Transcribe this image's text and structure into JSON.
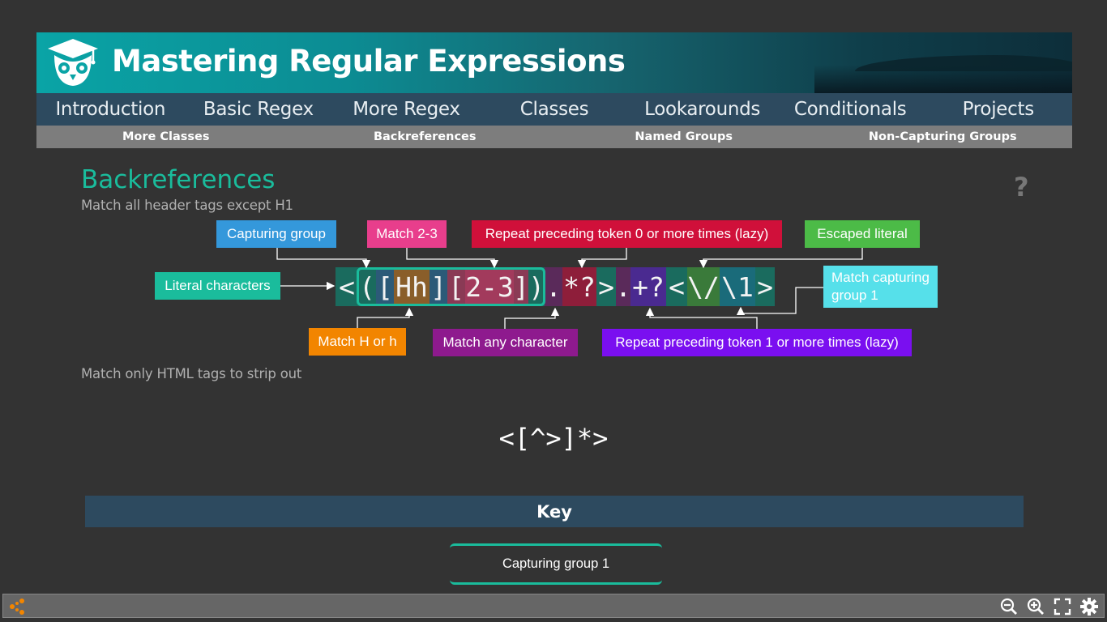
{
  "header": {
    "title": "Mastering Regular Expressions"
  },
  "nav": [
    {
      "label": "Introduction"
    },
    {
      "label": "Basic Regex"
    },
    {
      "label": "More Regex"
    },
    {
      "label": "Classes"
    },
    {
      "label": "Lookarounds"
    },
    {
      "label": "Conditionals"
    },
    {
      "label": "Projects"
    }
  ],
  "subnav": [
    {
      "label": "More Classes"
    },
    {
      "label": "Backreferences"
    },
    {
      "label": "Named Groups"
    },
    {
      "label": "Non-Capturing Groups"
    }
  ],
  "main": {
    "heading": "Backreferences",
    "help": "?",
    "example1": {
      "description": "Match all header tags except H1",
      "tokens": [
        {
          "text": "<",
          "color": "#1a6b5e"
        },
        {
          "text": "(",
          "color": "#1a6b5e"
        },
        {
          "text": "[",
          "color": "#2c5a78"
        },
        {
          "text": "Hh",
          "color": "#8a5e2a"
        },
        {
          "text": "]",
          "color": "#2c5a78"
        },
        {
          "text": "[",
          "color": "#8a3a55"
        },
        {
          "text": "2-3",
          "color": "#a23a5c"
        },
        {
          "text": "]",
          "color": "#8a3a55"
        },
        {
          "text": ")",
          "color": "#1a6b5e"
        },
        {
          "text": ".",
          "color": "#5a2a5a"
        },
        {
          "text": "*?",
          "color": "#8e1e3a"
        },
        {
          "text": ">",
          "color": "#1a6b5e"
        },
        {
          "text": ".",
          "color": "#5a2a5a"
        },
        {
          "text": "+?",
          "color": "#4a2a90"
        },
        {
          "text": "<",
          "color": "#1a6b5e"
        },
        {
          "text": "\\/",
          "color": "#3a7a3a"
        },
        {
          "text": "\\1",
          "color": "#1a6b7a"
        },
        {
          "text": ">",
          "color": "#1a6b5e"
        }
      ],
      "annotations": {
        "capturing_group": {
          "label": "Capturing group",
          "color": "#3498db"
        },
        "match_2_3": {
          "label": "Match 2-3",
          "color": "#e83e8c"
        },
        "repeat_lazy_0": {
          "label": "Repeat preceding token 0 or more times (lazy)",
          "color": "#d0103a"
        },
        "escaped_literal": {
          "label": "Escaped literal",
          "color": "#4cbb47"
        },
        "literal_characters": {
          "label": "Literal characters",
          "color": "#1abc9c"
        },
        "match_capturing_group_1": {
          "label": "Match capturing group 1",
          "color": "#56e0ea"
        },
        "match_h_or_h": {
          "label": "Match H or h",
          "color": "#f28500"
        },
        "match_any_character": {
          "label": "Match any character",
          "color": "#8e1a8e"
        },
        "repeat_lazy_1": {
          "label": "Repeat preceding token 1 or more times (lazy)",
          "color": "#7a0ff0"
        }
      }
    },
    "example2": {
      "description": "Match only HTML tags to strip out",
      "regex": "<[^>]*>"
    },
    "key": {
      "title": "Key",
      "items": [
        {
          "label": "Capturing group 1",
          "color": "#1abc9c"
        }
      ]
    }
  },
  "toolbar": {
    "left_icon": "share-icon",
    "right_icons": [
      "zoom-out-icon",
      "zoom-in-icon",
      "fullscreen-icon",
      "settings-gear-icon"
    ],
    "accent": "#f28500"
  }
}
